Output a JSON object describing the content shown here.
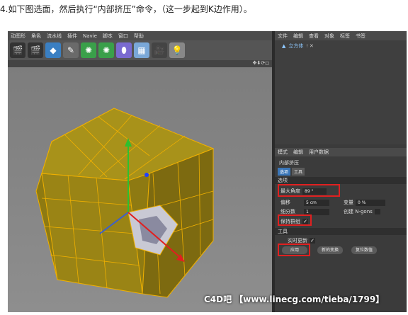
{
  "caption": "4.如下图选面，然后执行“内部挤压”命令，（这一步起到K边作用）。",
  "menubar": [
    "动图形",
    "角色",
    "流水线",
    "插件",
    "Navie",
    "脚本",
    "窗口",
    "帮助"
  ],
  "toolbar_icons": [
    "film-icon",
    "film-icon",
    "cube-icon",
    "pen-icon",
    "gear-icon",
    "gear-icon",
    "capsule-icon",
    "grid-icon",
    "camera-icon",
    "light-icon"
  ],
  "viewport": {
    "nav_icons": "✥⬇⟳◻"
  },
  "object_manager": {
    "tabs": [
      "文件",
      "编辑",
      "查看",
      "对象",
      "标签",
      "书签"
    ],
    "object_name": "立方体"
  },
  "attribute_manager": {
    "tabs": [
      "模式",
      "编辑",
      "用户数据"
    ],
    "title": "内部挤压",
    "mini_tabs": [
      "选项",
      "工具"
    ],
    "section_options": "选项",
    "max_angle_label": "最大角度",
    "max_angle_value": "89 °",
    "offset_label": "偏移",
    "offset_value": "5 cm",
    "variance_label": "变量",
    "variance_value": "0 %",
    "subdivision_label": "细分数",
    "subdivision_value": "1",
    "ngons_label": "创建 N-gons",
    "preserve_groups_label": "保持群组",
    "section_tool": "工具",
    "realtime_label": "实时更新",
    "apply_button": "应用",
    "new_transform_button": "新的变换",
    "reset_button": "复位数值"
  },
  "watermark": "C4D吧 【www.linecg.com/tieba/1799】"
}
